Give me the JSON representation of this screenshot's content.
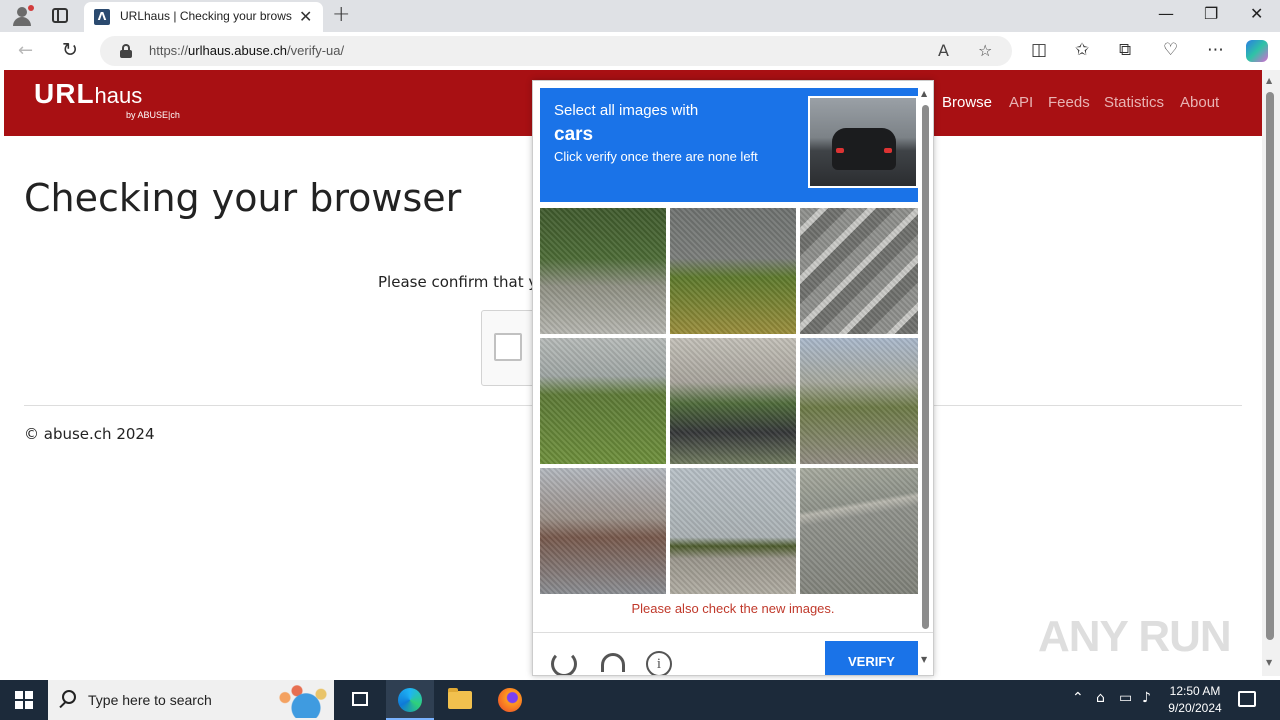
{
  "browser": {
    "tab_title": "URLhaus | Checking your browser",
    "tab_favicon": "Λ",
    "url_prefix": "https://",
    "url_domain": "urlhaus.abuse.ch",
    "url_path": "/verify-ua/",
    "icons": [
      "profile-icon",
      "tabs-icon",
      "close-icon",
      "new-tab-icon",
      "back-icon",
      "reload-icon",
      "lock-icon",
      "read-aloud-icon",
      "favorite-icon",
      "split-screen-icon",
      "favorites-icon",
      "collections-icon",
      "performance-icon",
      "more-icon",
      "copilot-icon"
    ]
  },
  "site": {
    "logo": "URL",
    "logo_suffix": "haus",
    "logo_sub": "by ABUSE|ch",
    "nav": [
      "Browse",
      "API",
      "Feeds",
      "Statistics",
      "About"
    ],
    "brand_color": "#a81013"
  },
  "page": {
    "title": "Checking your browser",
    "confirm_text": "Please confirm that yo",
    "footer": "© abuse.ch 2024"
  },
  "captcha": {
    "prompt_line1": "Select all images with",
    "prompt_target": "cars",
    "prompt_line3": "Click verify once there are none left",
    "error": "Please also check the new images.",
    "verify_label": "VERIFY",
    "accent_color": "#1a73e8",
    "icons": [
      "reload-icon",
      "audio-icon",
      "info-icon"
    ],
    "tiles": 9
  },
  "watermark": "ANY RUN",
  "taskbar": {
    "search_placeholder": "Type here to search",
    "time": "12:50 AM",
    "date": "9/20/2024"
  }
}
